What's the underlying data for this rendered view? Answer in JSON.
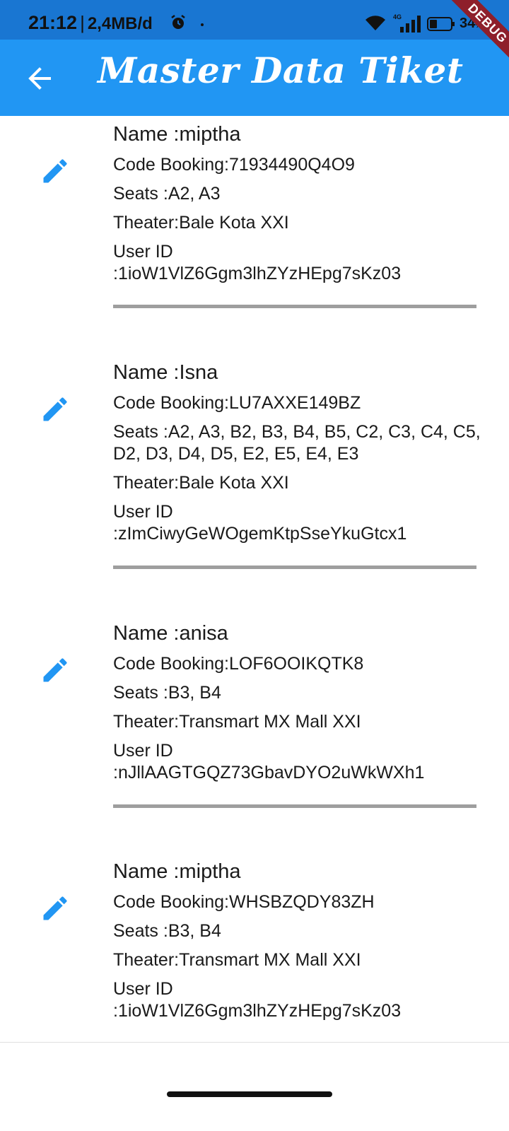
{
  "status_bar": {
    "time": "21:12",
    "separator": "|",
    "network_speed": "2,4MB/d",
    "network_type": "4G",
    "battery_percent": "34",
    "battery_unit": "%"
  },
  "debug_banner": "DEBUG",
  "app_bar": {
    "title": "Master Data Tiket",
    "back_icon": "arrow-back-icon"
  },
  "tickets": [
    {
      "name": "Name :miptha",
      "code_booking": "Code Booking:71934490Q4O9",
      "seats": "Seats :A2, A3",
      "theater": "Theater:Bale Kota XXI",
      "user_id": "User ID :1ioW1VlZ6Ggm3lhZYzHEpg7sKz03"
    },
    {
      "name": "Name :Isna",
      "code_booking": "Code Booking:LU7AXXE149BZ",
      "seats": "Seats :A2, A3, B2, B3, B4, B5, C2, C3, C4, C5, D2, D3, D4, D5, E2, E5, E4, E3",
      "theater": "Theater:Bale Kota XXI",
      "user_id": "User ID :zImCiwyGeWOgemKtpSseYkuGtcx1"
    },
    {
      "name": "Name :anisa",
      "code_booking": "Code Booking:LOF6OOIKQTK8",
      "seats": "Seats :B3, B4",
      "theater": "Theater:Transmart MX Mall XXI",
      "user_id": "User ID :nJllAAGTGQZ73GbavDYO2uWkWXh1"
    },
    {
      "name": "Name :miptha",
      "code_booking": "Code Booking:WHSBZQDY83ZH",
      "seats": "Seats :B3, B4",
      "theater": "Theater:Transmart MX Mall XXI",
      "user_id": "User ID :1ioW1VlZ6Ggm3lhZYzHEpg7sKz03"
    }
  ],
  "colors": {
    "app_bar": "#2196f3",
    "status_bar": "#1976d2",
    "edit_icon": "#2196f3",
    "divider": "#9e9e9e"
  }
}
